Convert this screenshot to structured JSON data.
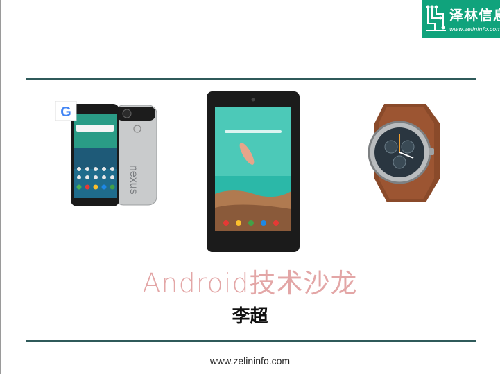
{
  "logo": {
    "name": "泽林信息",
    "url": "www.zelininfo.com"
  },
  "slide": {
    "title": "Android技术沙龙",
    "presenter": "李超",
    "footer_url": "www.zelininfo.com"
  },
  "devices": {
    "phone_brand": "nexus",
    "google_badge": "G"
  },
  "colors": {
    "logo_bg": "#10a37c",
    "rule": "#2f5a5a",
    "title": "#e3a6a6"
  }
}
